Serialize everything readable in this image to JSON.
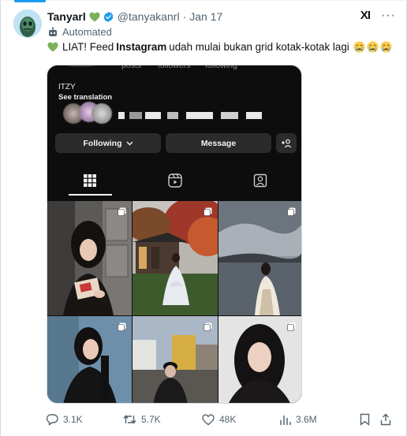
{
  "tweet": {
    "author_name": "Tanyarl",
    "handle": "@tanyakanrl",
    "separator": "·",
    "date": "Jan 17",
    "automated_label": "Automated",
    "text_before": "LIAT! Feed",
    "text_bold": "Instagram",
    "text_after": "udah mulai bukan grid kotak-kotak lagi",
    "grok_label": "XI",
    "more_label": "···"
  },
  "instagram": {
    "stats": [
      "posts",
      "followers",
      "following"
    ],
    "profile_name": "ITZY",
    "see_translation": "See translation",
    "following_button": "Following",
    "message_button": "Message",
    "tabs": [
      "grid-icon",
      "reels-icon",
      "tagged-icon"
    ]
  },
  "actions": {
    "replies": "3.1K",
    "reposts": "5.7K",
    "likes": "48K",
    "views": "3.6M"
  },
  "colors": {
    "accent": "#1d9bf0",
    "heart": "#78b159",
    "text_secondary": "#536471",
    "ig_dark": "#0d0d0d"
  }
}
